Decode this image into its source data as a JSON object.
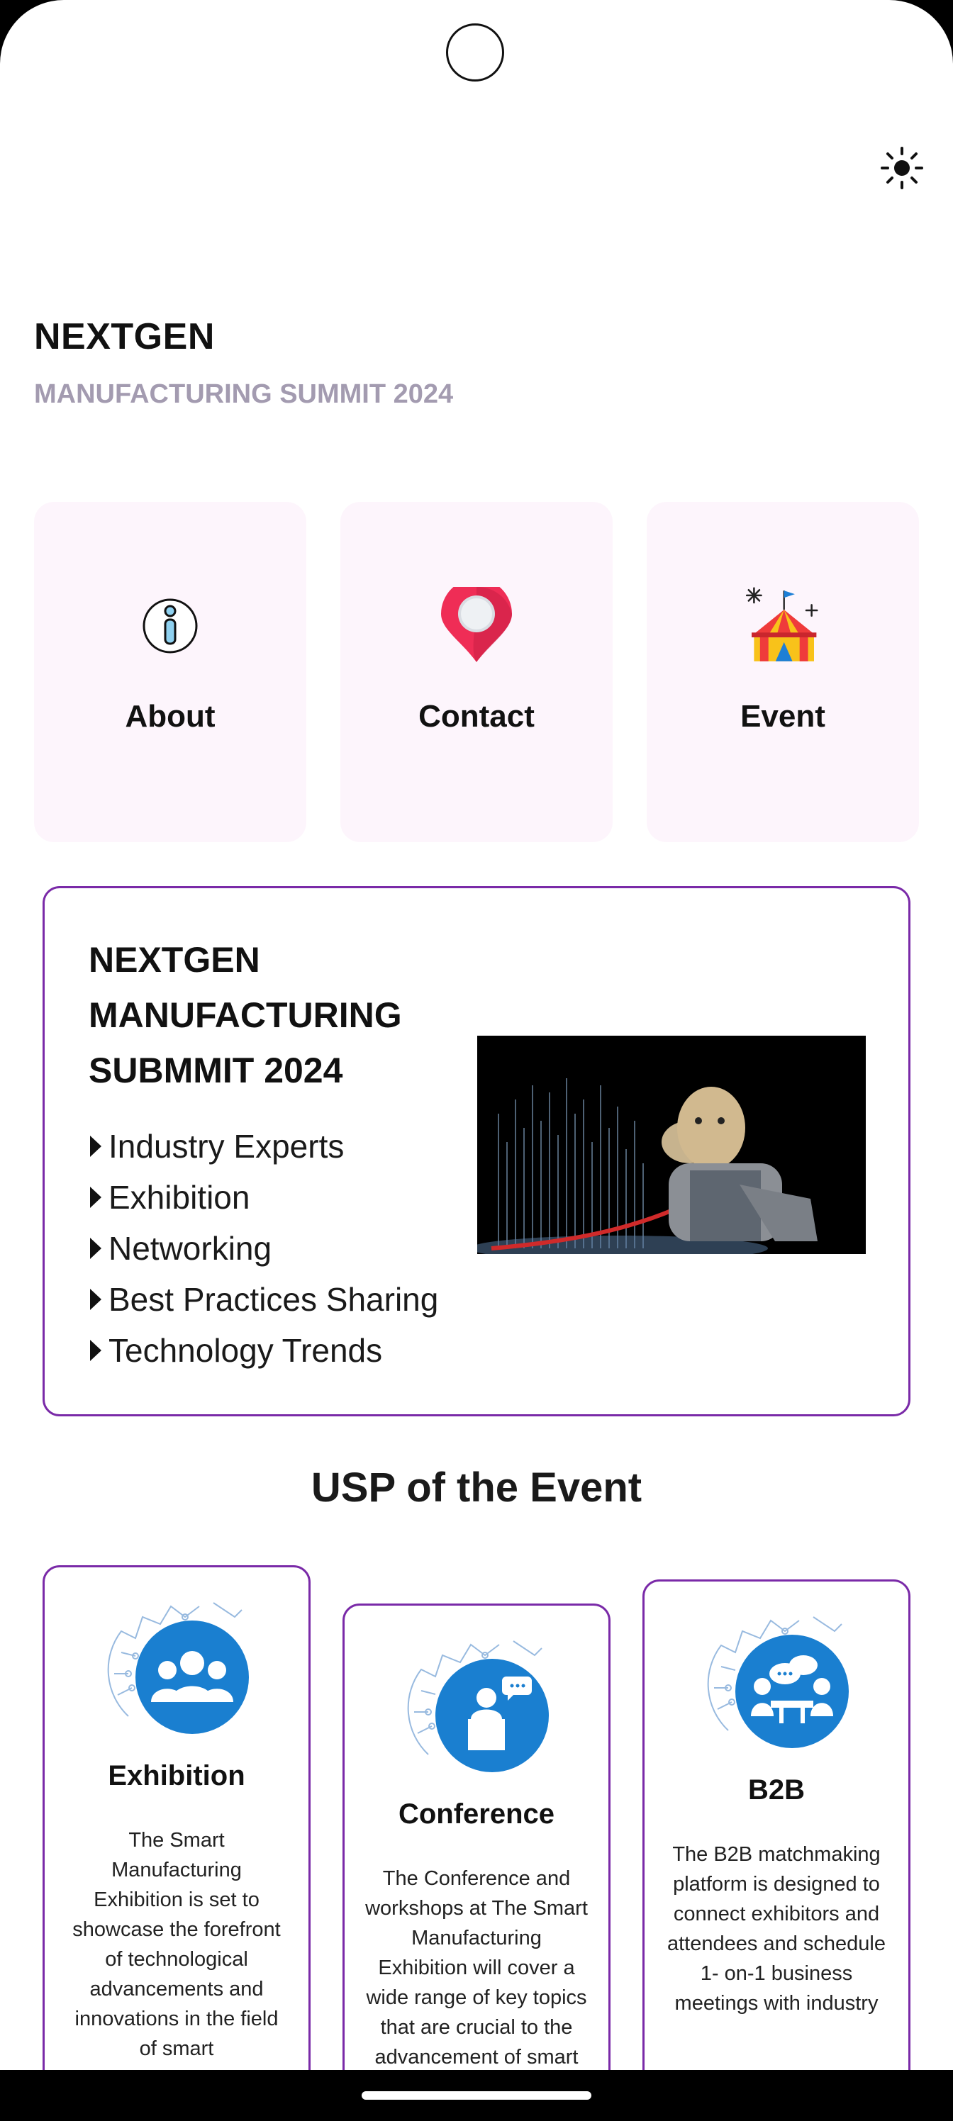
{
  "header": {
    "title": "NEXTGEN",
    "subtitle": "MANUFACTURING SUMMIT 2024",
    "theme_icon": "sun-icon"
  },
  "tiles": [
    {
      "label": "About",
      "icon": "info-icon"
    },
    {
      "label": "Contact",
      "icon": "location-pin-icon"
    },
    {
      "label": "Event",
      "icon": "circus-tent-icon"
    }
  ],
  "hero": {
    "title": "NEXTGEN MANUFACTURING SUBMMIT 2024",
    "highlights": [
      "Industry Experts",
      "Exhibition",
      "Networking",
      "Best Practices Sharing",
      "Technology Trends"
    ]
  },
  "usp": {
    "title": "USP of the Event",
    "cards": [
      {
        "title": "Exhibition",
        "body": "The Smart Manufacturing Exhibition is set to showcase the forefront of technological advancements and innovations in the field of smart",
        "icon": "exhibition-people-icon"
      },
      {
        "title": "Conference",
        "body": "The Conference and workshops at The Smart Manufacturing Exhibition will cover a wide range of key topics that are crucial to the advancement of smart manufacturing",
        "icon": "conference-speaker-icon"
      },
      {
        "title": "B2B",
        "body": "The B2B matchmaking platform is designed to connect exhibitors and attendees and schedule 1- on-1 business meetings with industry",
        "icon": "b2b-meeting-icon"
      }
    ]
  },
  "colors": {
    "accent": "#7a2aa8",
    "tile_bg": "#fdf5fc",
    "subtitle": "#a39bb0",
    "icon_blue": "#1a7fd0"
  }
}
